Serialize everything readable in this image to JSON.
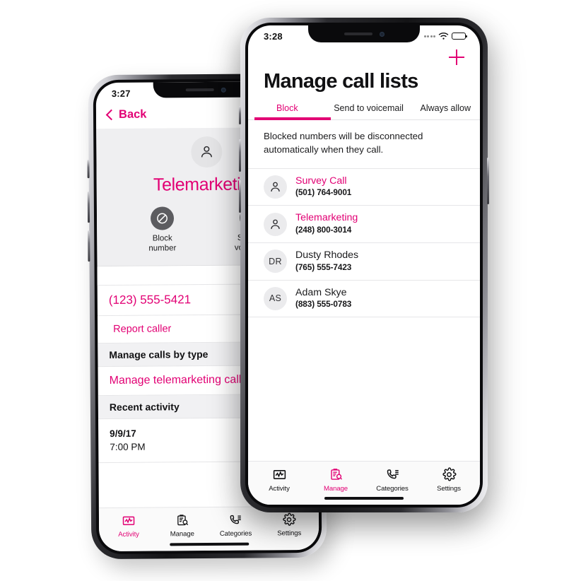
{
  "accent": "#e20074",
  "back_phone": {
    "status": {
      "time": "3:27"
    },
    "nav": {
      "back_label": "Back"
    },
    "hero": {
      "name": "Telemarketing",
      "avatar_icon": "person-icon",
      "actions": [
        {
          "icon": "block-circle-icon",
          "line1": "Block",
          "line2": "number"
        },
        {
          "icon": "voicemail-forward-icon",
          "line1": "Send to",
          "line2": "voicemail"
        }
      ]
    },
    "rows": {
      "phone_number": "(123) 555-5421",
      "report_caller": "Report caller",
      "manage_by_type_header": "Manage calls by type",
      "manage_telemarketing": "Manage telemarketing calls",
      "recent_activity_header": "Recent activity",
      "activity_date": "9/9/17",
      "activity_time": "7:00 PM"
    },
    "tabbar": [
      {
        "icon": "activity-chart-icon",
        "label": "Activity",
        "active": true
      },
      {
        "icon": "clipboard-search-icon",
        "label": "Manage",
        "active": false
      },
      {
        "icon": "phone-list-icon",
        "label": "Categories",
        "active": false
      },
      {
        "icon": "gear-icon",
        "label": "Settings",
        "active": false
      }
    ]
  },
  "front_phone": {
    "status": {
      "time": "3:28",
      "wifi_icon": "wifi-icon",
      "battery_icon": "battery-icon",
      "signal_icon": "signal-dots-icon"
    },
    "add_button": {
      "icon": "plus-icon",
      "label": "+"
    },
    "title": "Manage call lists",
    "tabs": [
      {
        "label": "Block",
        "active": true
      },
      {
        "label": "Send to voicemail",
        "active": false
      },
      {
        "label": "Always allow",
        "active": false
      }
    ],
    "blurb": "Blocked numbers will be disconnected automatically when they call.",
    "contacts": [
      {
        "avatar_type": "icon",
        "avatar_icon": "person-icon",
        "initials": "",
        "name": "Survey Call",
        "name_pink": true,
        "number": "(501) 764-9001"
      },
      {
        "avatar_type": "icon",
        "avatar_icon": "person-icon",
        "initials": "",
        "name": "Telemarketing",
        "name_pink": true,
        "number": "(248) 800-3014"
      },
      {
        "avatar_type": "initials",
        "avatar_icon": "",
        "initials": "DR",
        "name": "Dusty Rhodes",
        "name_pink": false,
        "number": "(765) 555-7423"
      },
      {
        "avatar_type": "initials",
        "avatar_icon": "",
        "initials": "AS",
        "name": "Adam Skye",
        "name_pink": false,
        "number": "(883) 555-0783"
      }
    ],
    "tabbar": [
      {
        "icon": "activity-chart-icon",
        "label": "Activity",
        "active": false
      },
      {
        "icon": "clipboard-search-icon",
        "label": "Manage",
        "active": true
      },
      {
        "icon": "phone-list-icon",
        "label": "Categories",
        "active": false
      },
      {
        "icon": "gear-icon",
        "label": "Settings",
        "active": false
      }
    ]
  }
}
